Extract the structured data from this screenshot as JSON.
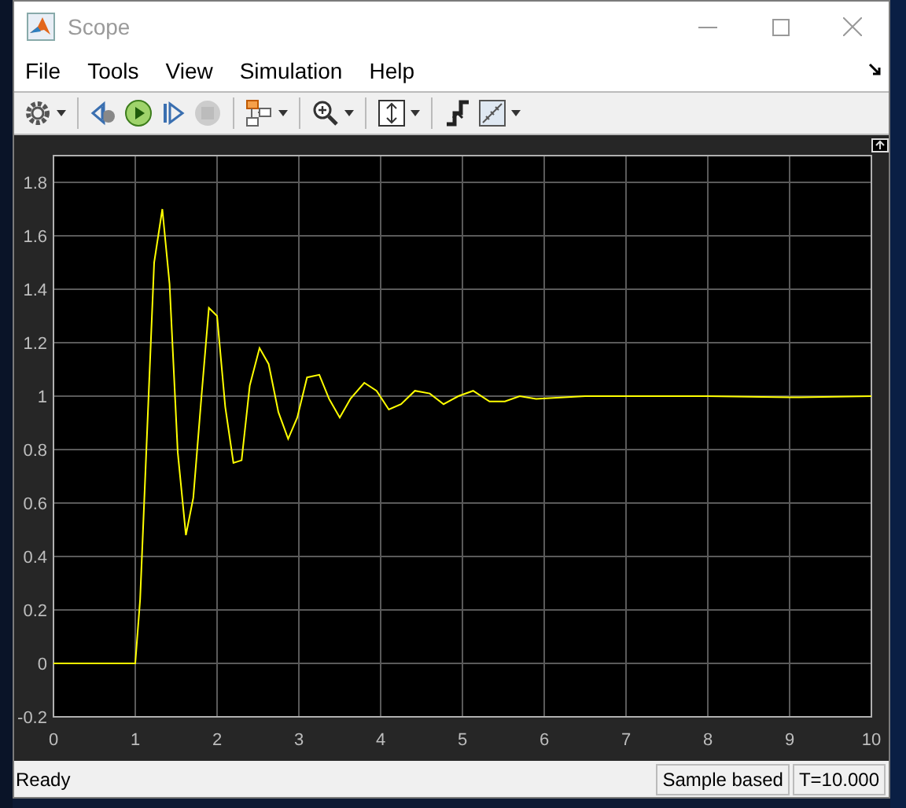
{
  "window": {
    "title": "Scope"
  },
  "menu": [
    "File",
    "Tools",
    "View",
    "Simulation",
    "Help"
  ],
  "toolbar": [
    {
      "kind": "settings",
      "dropdown": true,
      "disabled": false
    },
    {
      "kind": "step-back",
      "dropdown": false,
      "disabled": false
    },
    {
      "kind": "run",
      "dropdown": false,
      "disabled": false
    },
    {
      "kind": "step-forward",
      "dropdown": false,
      "disabled": false
    },
    {
      "kind": "stop",
      "dropdown": false,
      "disabled": true
    },
    {
      "kind": "highlight",
      "dropdown": true,
      "disabled": false
    },
    {
      "kind": "zoom",
      "dropdown": true,
      "disabled": false
    },
    {
      "kind": "autoscale",
      "dropdown": true,
      "disabled": false
    },
    {
      "kind": "trigger",
      "dropdown": false,
      "disabled": false
    },
    {
      "kind": "measure",
      "dropdown": true,
      "disabled": false
    }
  ],
  "plot": {
    "chart_data": {
      "type": "line",
      "grid": true,
      "xlim": [
        0,
        10
      ],
      "ylim": [
        -0.2,
        1.9
      ],
      "xticks": [
        0,
        1,
        2,
        3,
        4,
        5,
        6,
        7,
        8,
        9,
        10
      ],
      "yticks": [
        -0.2,
        0,
        0.2,
        0.4,
        0.6,
        0.8,
        1,
        1.2,
        1.4,
        1.6,
        1.8
      ],
      "x": [
        0,
        1,
        1.06,
        1.23,
        1.33,
        1.42,
        1.52,
        1.62,
        1.71,
        1.81,
        1.9,
        2.0,
        2.1,
        2.2,
        2.3,
        2.4,
        2.52,
        2.63,
        2.75,
        2.87,
        2.98,
        3.1,
        3.25,
        3.37,
        3.5,
        3.63,
        3.8,
        3.95,
        4.1,
        4.25,
        4.42,
        4.6,
        4.77,
        4.95,
        5.13,
        5.33,
        5.52,
        5.7,
        5.9,
        6.5,
        7,
        8,
        9,
        10
      ],
      "series": [
        {
          "color": "#ffff00",
          "values": [
            0,
            0,
            0.24,
            1.5,
            1.7,
            1.42,
            0.79,
            0.48,
            0.62,
            1.0,
            1.33,
            1.3,
            0.96,
            0.75,
            0.76,
            1.04,
            1.18,
            1.12,
            0.94,
            0.84,
            0.92,
            1.07,
            1.08,
            0.99,
            0.92,
            0.99,
            1.05,
            1.02,
            0.95,
            0.97,
            1.02,
            1.01,
            0.97,
            1.0,
            1.02,
            0.98,
            0.98,
            1.0,
            0.99,
            1.0,
            1.0,
            1.0,
            0.995,
            1.0
          ]
        }
      ]
    }
  },
  "status_bar": {
    "message": "Ready",
    "mode": "Sample based",
    "time": "T=10.000"
  }
}
